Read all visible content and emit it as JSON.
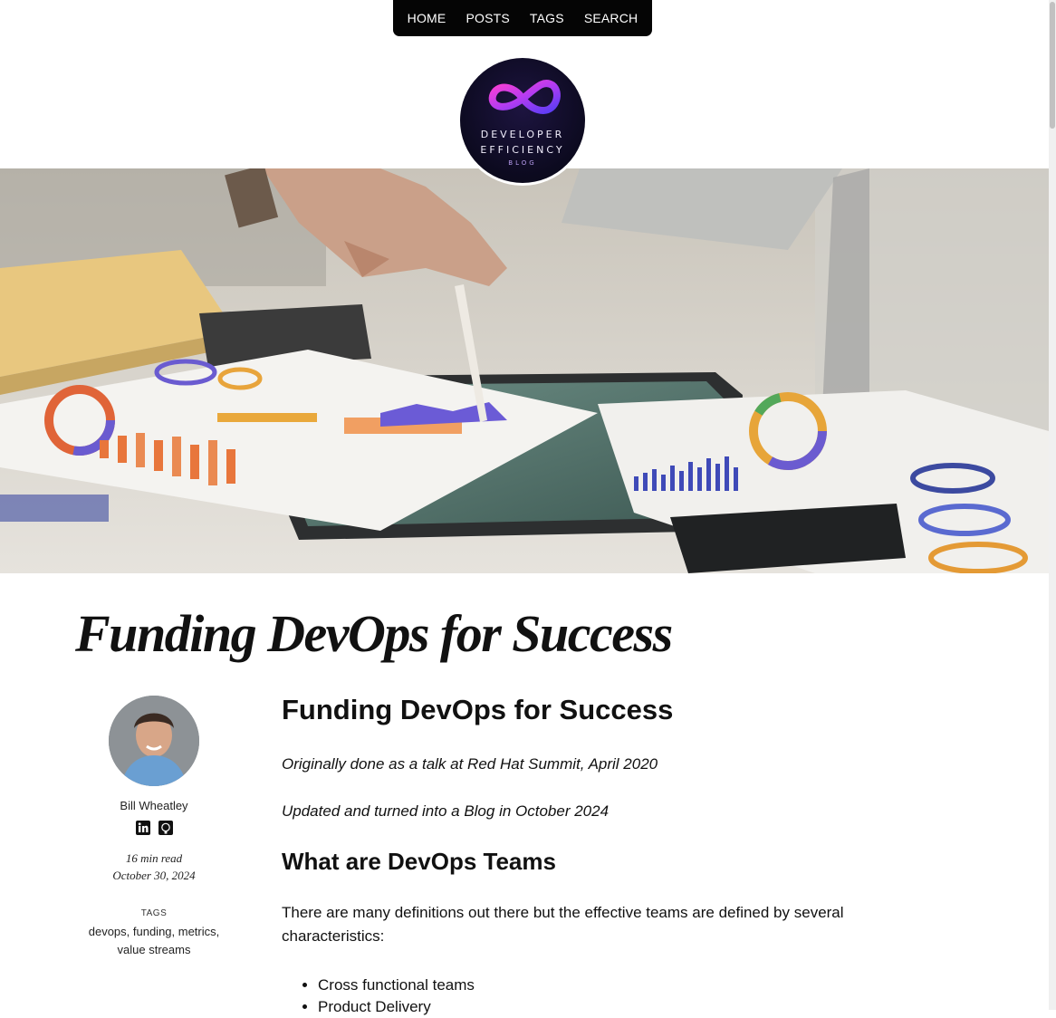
{
  "nav": {
    "items": [
      {
        "label": "HOME"
      },
      {
        "label": "POSTS"
      },
      {
        "label": "TAGS"
      },
      {
        "label": "SEARCH"
      }
    ]
  },
  "logo": {
    "line1": "DEVELOPER",
    "line2": "EFFICIENCY",
    "line3": "BLOG",
    "icon": "infinity-icon"
  },
  "hero": {
    "description_icon": "hero-image"
  },
  "post": {
    "title": "Funding DevOps for Success"
  },
  "sidebar": {
    "author": "Bill Wheatley",
    "social_icons": [
      "linkedin-icon",
      "github-icon"
    ],
    "read_time": "16 min read",
    "date": "October 30, 2024",
    "tags_heading": "TAGS",
    "tags_line1": "devops, funding, metrics,",
    "tags_line2": "value streams"
  },
  "content": {
    "heading": "Funding DevOps for Success",
    "intro1": "Originally done as a talk at Red Hat Summit, April 2020",
    "intro2": "Updated and turned into a Blog in October 2024",
    "section_heading": "What are DevOps Teams",
    "paragraph": "There are many definitions out there but the effective teams are defined by several characteristics:",
    "list": [
      "Cross functional teams",
      "Product Delivery"
    ]
  },
  "colors": {
    "nav_bg": "#050505",
    "logo_bg": "#0c0a1f",
    "logo_accent": "#c13cf0"
  }
}
